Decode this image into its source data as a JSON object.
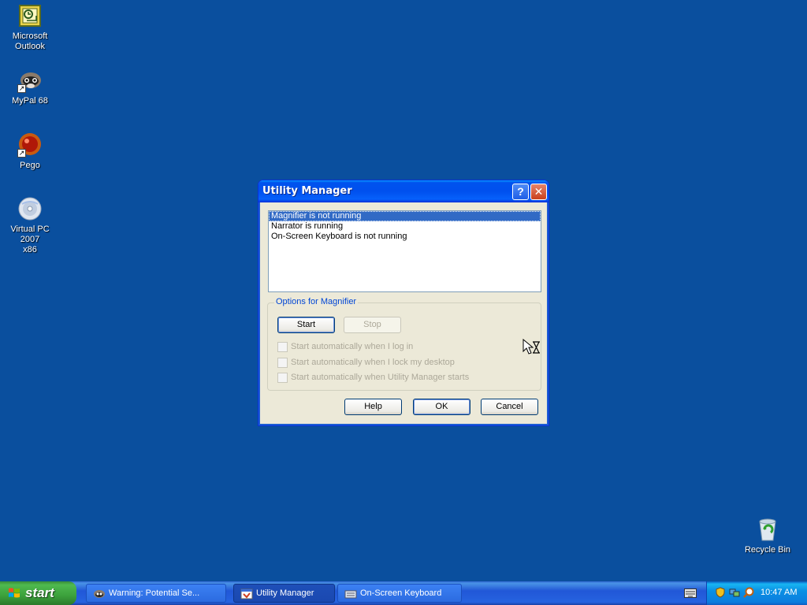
{
  "desktop": {
    "icons": [
      {
        "label_line1": "Microsoft",
        "label_line2": "Outlook",
        "icon": "outlook-icon"
      },
      {
        "label_line1": "MyPal 68",
        "label_line2": "",
        "icon": "mypal-icon"
      },
      {
        "label_line1": "Pego",
        "label_line2": "",
        "icon": "pego-icon"
      },
      {
        "label_line1": "Virtual PC 2007",
        "label_line2": "x86",
        "icon": "virtual-pc-icon"
      },
      {
        "label_line1": "Recycle Bin",
        "label_line2": "",
        "icon": "recycle-bin-icon"
      }
    ]
  },
  "dialog": {
    "title": "Utility Manager",
    "help_glyph": "?",
    "close_glyph": "✕",
    "list": [
      "Magnifier is not running",
      "Narrator is running",
      "On-Screen Keyboard is not running"
    ],
    "group_label": "Options for Magnifier",
    "start_label": "Start",
    "stop_label": "Stop",
    "checkboxes": [
      "Start automatically when I log in",
      "Start automatically when I lock my desktop",
      "Start automatically when Utility Manager starts"
    ],
    "help_label": "Help",
    "ok_label": "OK",
    "cancel_label": "Cancel"
  },
  "taskbar": {
    "start_label": "start",
    "tasks": [
      {
        "label": "Warning: Potential Se...",
        "icon": "mypal-icon"
      },
      {
        "label": "Utility Manager",
        "icon": "utility-manager-icon"
      },
      {
        "label": "On-Screen Keyboard",
        "icon": "keyboard-icon"
      }
    ],
    "clock": "10:47 AM"
  },
  "colors": {
    "desktop_bg": "#0a4f9e",
    "title_blue": "#0053ee",
    "selection": "#316ac5",
    "start_green": "#3ca13c"
  }
}
